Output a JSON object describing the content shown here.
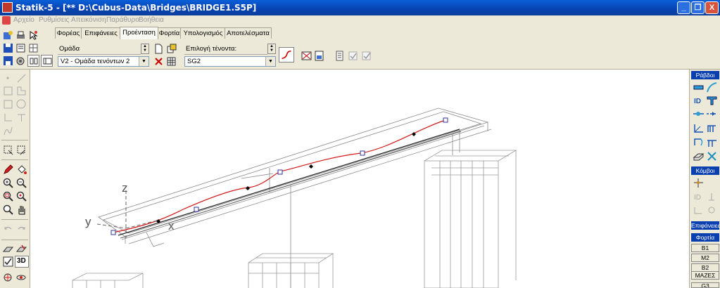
{
  "window": {
    "title": "Statik-5 - [** D:\\Cubus-Data\\Bridges\\BRIDGE1.S5P]",
    "controls": [
      "_",
      "❐",
      "X"
    ]
  },
  "menu": [
    "Αρχείο",
    "Ρυθμίσεις",
    "Απεικόνιση",
    "Παράθυρο",
    "Βοήθεια"
  ],
  "tabs": [
    "Φορέας",
    "Επιφάνειες",
    "Προένταση",
    "Φορτία",
    "Υπολογισμός",
    "Αποτελέσματα"
  ],
  "active_tab": 2,
  "prestress": {
    "group_label": "Ομάδα",
    "group_value": "V2 - Ομάδα τενόντων 2",
    "tendon_label": "Επιλογή τένοντα:",
    "tendon_value": "SG2"
  },
  "viewport": {
    "axis_z": "z",
    "axis_y": "y",
    "axis_x": "x"
  },
  "left_toolbar": {
    "view3d_label": "3D"
  },
  "right_panel": {
    "rods_header": "Ράβδοι",
    "nodes_header": "Κόμβοι",
    "surfaces_header": "Επιφάνειες",
    "loads_header": "Φορτία",
    "loads": [
      "B1",
      "M2",
      "B2",
      "ΜΑΖΕΣ"
    ],
    "loads_bottom": "G3"
  },
  "colors": {
    "title_bar": "#0a4bc4",
    "panel_header": "#0a3fb0",
    "tendon": "#d01818",
    "structure": "#888888"
  }
}
